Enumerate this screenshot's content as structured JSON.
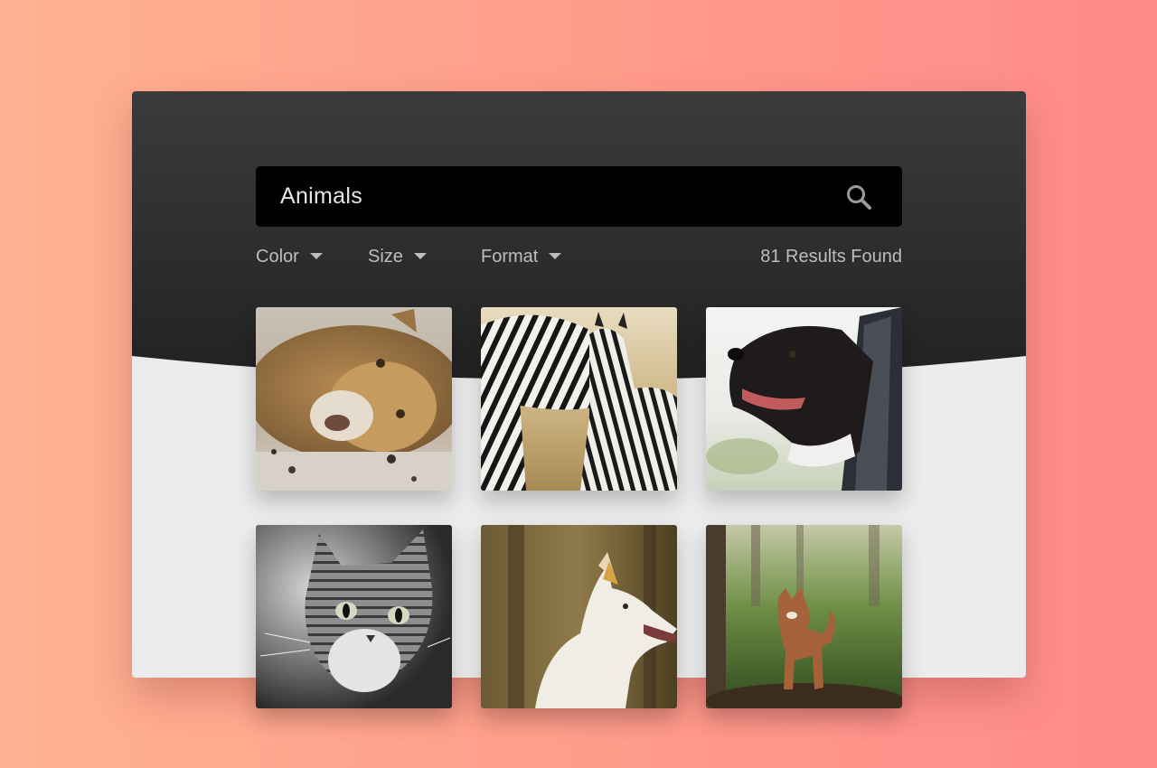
{
  "search": {
    "value": "Animals",
    "icon": "search-icon"
  },
  "filters": [
    {
      "label": "Color"
    },
    {
      "label": "Size"
    },
    {
      "label": "Format"
    }
  ],
  "results_text": "81 Results Found",
  "images": [
    {
      "subject": "lion"
    },
    {
      "subject": "zebras"
    },
    {
      "subject": "dog-in-car-window"
    },
    {
      "subject": "kitten"
    },
    {
      "subject": "white-dog"
    },
    {
      "subject": "dog-in-forest"
    }
  ],
  "colors": {
    "header": "#2a2a2a",
    "card": "#ececec",
    "search_bg": "#000000",
    "filter_text": "#bdbdbd"
  }
}
